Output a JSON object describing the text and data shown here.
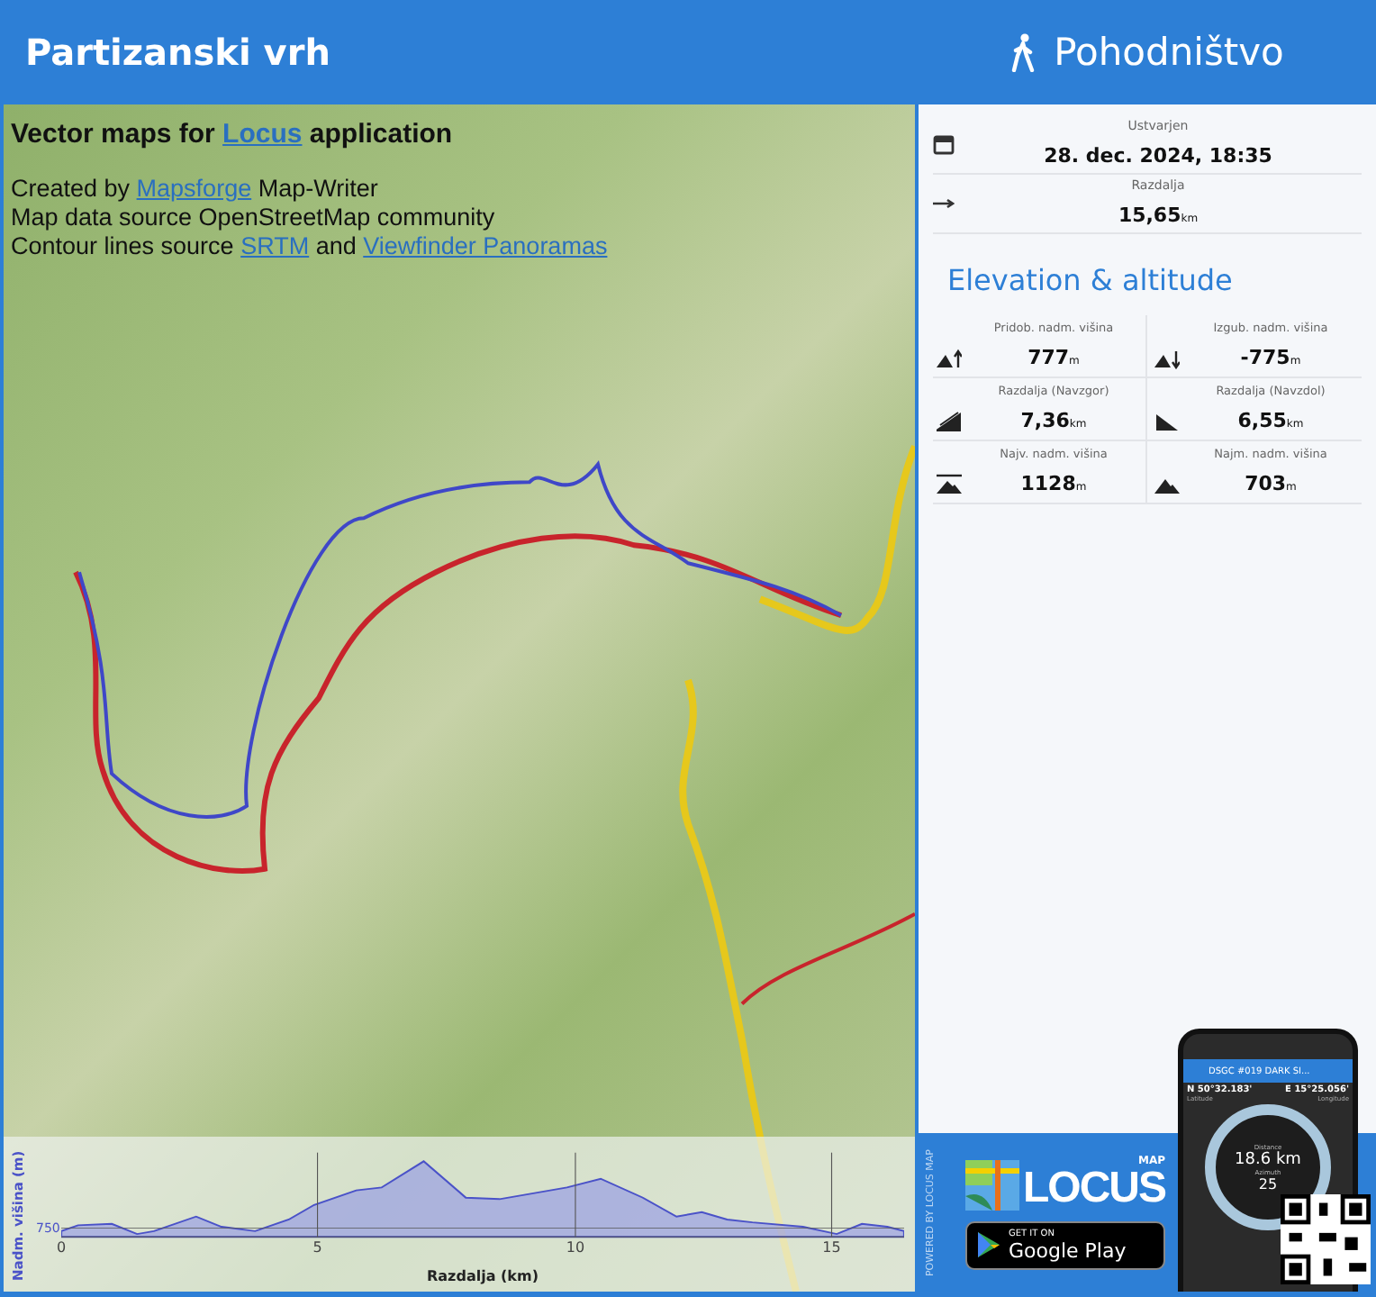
{
  "header": {
    "title": "Partizanski vrh",
    "activity": "Pohodništvo"
  },
  "map": {
    "attribution_title": [
      {
        "text": "Vector maps for ",
        "link": false
      },
      {
        "text": "Locus",
        "link": true
      },
      {
        "text": " application",
        "link": false
      }
    ],
    "attribution_lines": [
      [
        {
          "text": "Created by ",
          "link": false
        },
        {
          "text": "Mapsforge",
          "link": true
        },
        {
          "text": " Map-Writer",
          "link": false
        }
      ],
      [
        {
          "text": "Map data source OpenStreetMap community",
          "link": false
        }
      ],
      [
        {
          "text": "Contour lines source ",
          "link": false
        },
        {
          "text": "SRTM",
          "link": true
        },
        {
          "text": " and ",
          "link": false
        },
        {
          "text": "Viewfinder Panoramas",
          "link": true
        }
      ]
    ]
  },
  "profile": {
    "ylabel": "Nadm. višina (m)",
    "ytick": "750",
    "xticks": [
      "0",
      "5",
      "10",
      "15"
    ],
    "xlabel": "Razdalja (km)"
  },
  "info": [
    {
      "kind": "date",
      "label": "Ustvarjen",
      "value": "28. dec. 2024, 18:35"
    },
    {
      "kind": "distance",
      "label": "Razdalja",
      "value": "15,65",
      "unit": "km"
    }
  ],
  "section_title": "Elevation & altitude",
  "elevation": [
    {
      "kind": "gain",
      "label": "Pridob. nadm. višina",
      "value": "777",
      "unit": "m"
    },
    {
      "kind": "loss",
      "label": "Izgub. nadm. višina",
      "value": "-775",
      "unit": "m"
    },
    {
      "kind": "uphill",
      "label": "Razdalja (Navzgor)",
      "value": "7,36",
      "unit": "km"
    },
    {
      "kind": "downhill",
      "label": "Razdalja (Navzdol)",
      "value": "6,55",
      "unit": "km"
    },
    {
      "kind": "max",
      "label": "Najv. nadm. višina",
      "value": "1128",
      "unit": "m"
    },
    {
      "kind": "min",
      "label": "Najm. nadm. višina",
      "value": "703",
      "unit": "m"
    }
  ],
  "promo": {
    "powered_by": "POWERED BY LOCUS MAP",
    "logo_small": "MAP",
    "logo": "LOCUS",
    "store_top": "GET IT ON",
    "store_name": "Google Play",
    "phone": {
      "title": "DSGC #019 DARK SI...",
      "lat": "N 50°32.183'",
      "lon": "E 15°25.056'",
      "lat_label": "Latitude",
      "lon_label": "Longitude",
      "distance_label": "Distance",
      "distance": "18.6 km",
      "azimuth_label": "Azimuth",
      "azimuth": "25"
    }
  }
}
